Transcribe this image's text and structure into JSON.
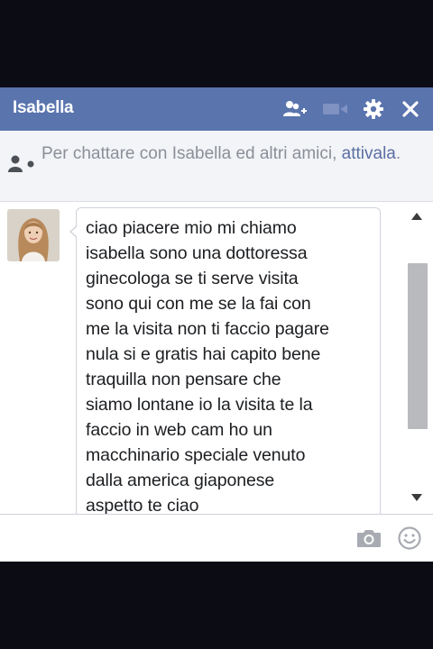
{
  "window": {
    "title": "Isabella",
    "header_color": "#5a74ad",
    "icons": {
      "add_friend": "add-friend-icon",
      "video_call": "video-camera-icon",
      "settings": "gear-icon",
      "close": "close-icon"
    }
  },
  "notice": {
    "text": "Per chattare con Isabella ed altri amici, ",
    "link": "attivala",
    "period": ".",
    "icon": "person-online-icon"
  },
  "conversation": {
    "sender_avatar": "avatar",
    "message": "ciao piacere mio mi chiamo\nisabella sono una dottoressa\nginecologa se ti serve visita\nsono qui con me se la fai con\nme la visita non ti faccio pagare\nnula si e gratis hai capito bene\ntraquilla non pensare che\nsiamo  lontane  io la visita te la\nfaccio  in web cam ho un\nmacchinario speciale venuto\ndalla america  giaponese\naspetto te ciao"
  },
  "compose": {
    "placeholder": "",
    "icons": {
      "photo": "camera-icon",
      "emoji": "smiley-icon"
    }
  }
}
